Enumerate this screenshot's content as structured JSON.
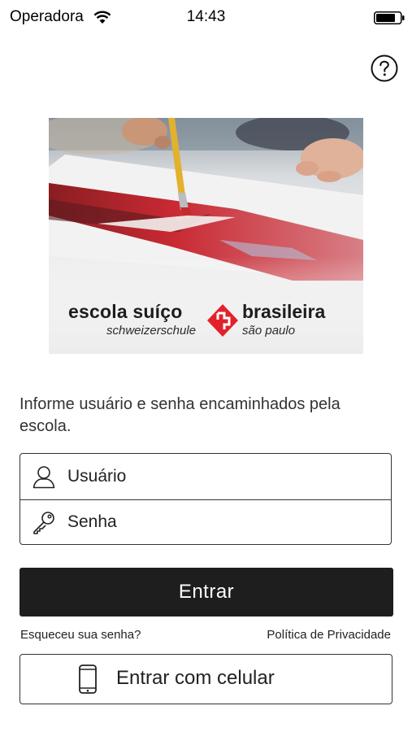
{
  "status_bar": {
    "carrier": "Operadora",
    "time": "14:43",
    "wifi_icon": "wifi-icon",
    "battery_icon": "battery-icon"
  },
  "help": {
    "icon": "question-circle-icon"
  },
  "banner": {
    "logo_left": "escola suíço",
    "logo_right": "brasileira",
    "sub_left": "schweizerschule",
    "sub_right": "são paulo",
    "mark_color": "#e2222a"
  },
  "instructions": "Informe usuário e senha encaminhados pela escola.",
  "form": {
    "username_placeholder": "Usuário",
    "username_icon": "user-icon",
    "password_placeholder": "Senha",
    "password_icon": "key-icon"
  },
  "actions": {
    "enter_label": "Entrar",
    "forgot_password": "Esqueceu sua senha?",
    "privacy_policy": "Política de Privacidade",
    "phone_login_label": "Entrar com celular",
    "phone_icon": "smartphone-icon"
  },
  "colors": {
    "primary_button": "#1f1e1e",
    "text": "#1d1d1d",
    "border": "#333333",
    "brand_red": "#e2222a"
  }
}
